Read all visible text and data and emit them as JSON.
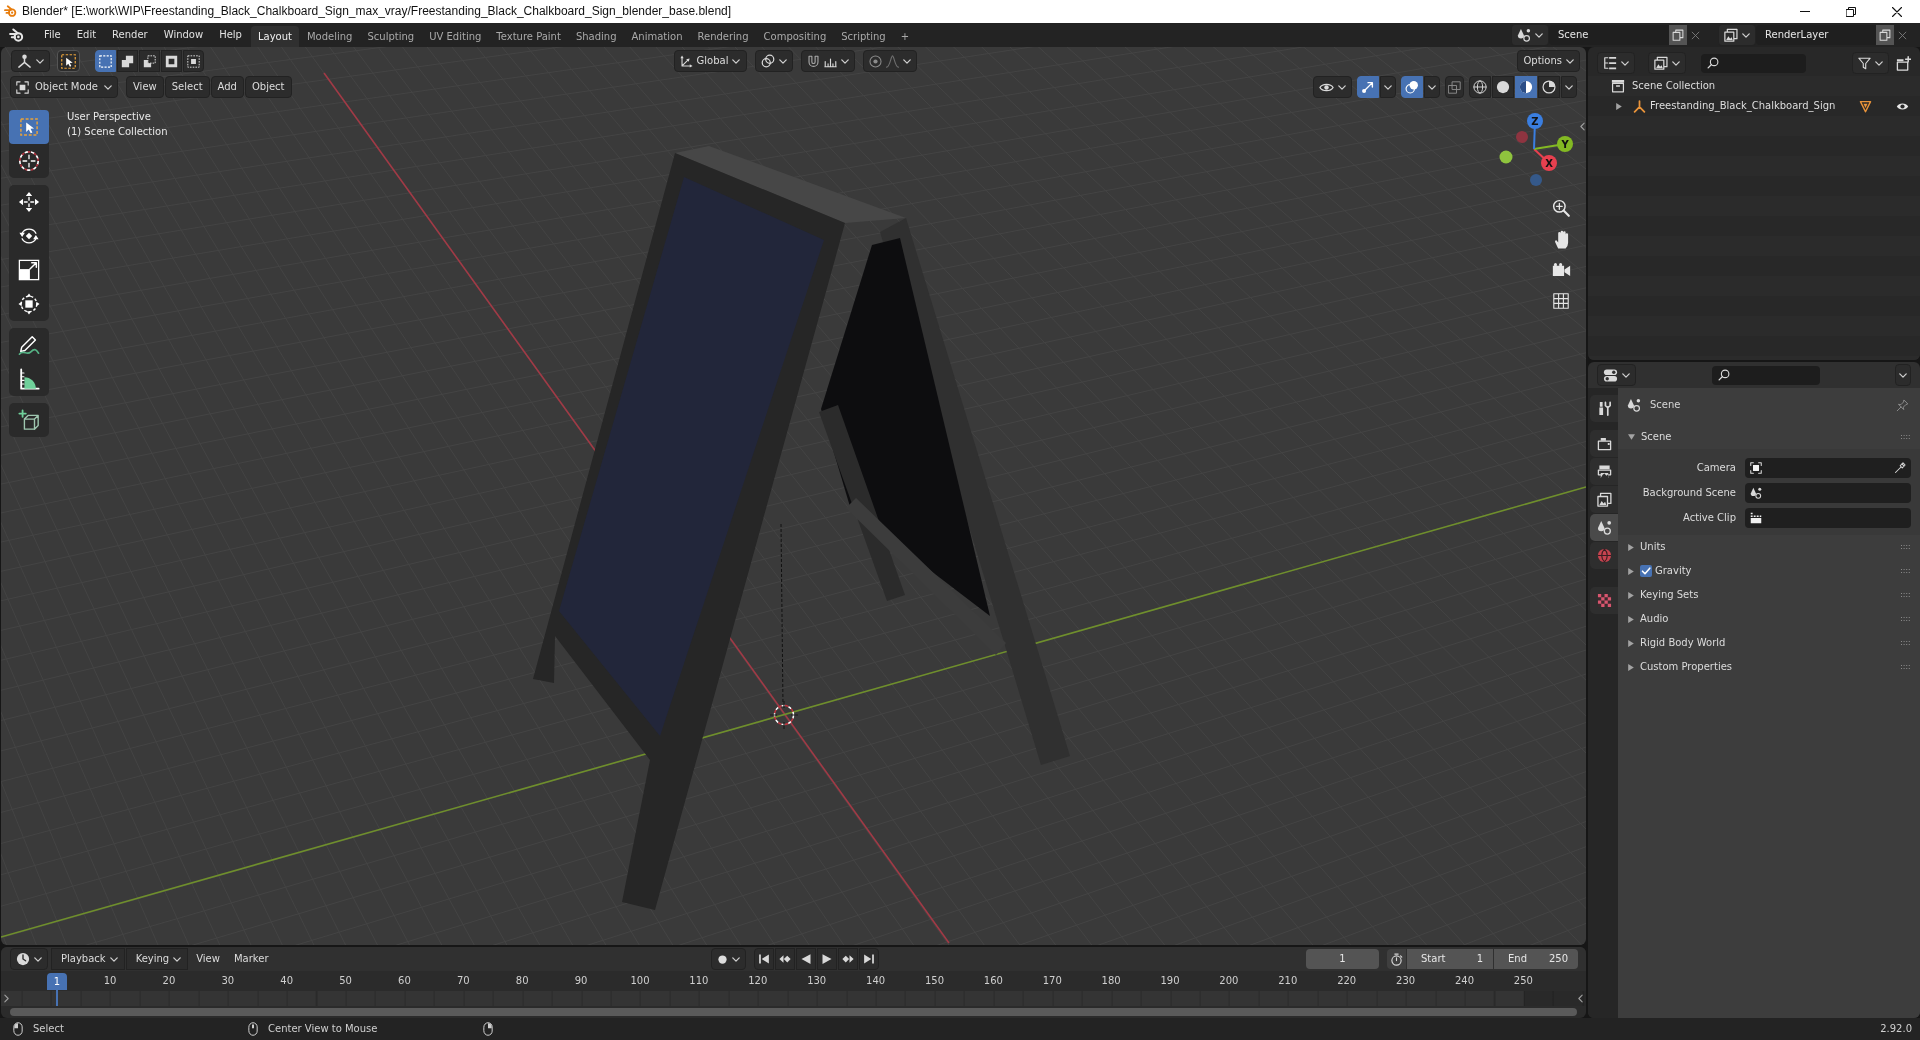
{
  "window": {
    "title": "Blender* [E:\\work\\WIP\\Freestanding_Black_Chalkboard_Sign_max_vray/Freestanding_Black_Chalkboard_Sign_blender_base.blend]"
  },
  "topbar": {
    "menus": [
      "File",
      "Edit",
      "Render",
      "Window",
      "Help"
    ],
    "workspaces": [
      {
        "label": "Layout",
        "selected": true
      },
      {
        "label": "Modeling",
        "selected": false
      },
      {
        "label": "Sculpting",
        "selected": false
      },
      {
        "label": "UV Editing",
        "selected": false
      },
      {
        "label": "Texture Paint",
        "selected": false
      },
      {
        "label": "Shading",
        "selected": false
      },
      {
        "label": "Animation",
        "selected": false
      },
      {
        "label": "Rendering",
        "selected": false
      },
      {
        "label": "Compositing",
        "selected": false
      },
      {
        "label": "Scripting",
        "selected": false
      }
    ],
    "add_workspace": "+",
    "scene": "Scene",
    "view_layer": "RenderLayer"
  },
  "viewport": {
    "select_modes": [
      {
        "kind": "set",
        "selected": true
      },
      {
        "kind": "extend",
        "selected": false
      },
      {
        "kind": "subtract",
        "selected": false
      },
      {
        "kind": "invert",
        "selected": false
      },
      {
        "kind": "intersect",
        "selected": false
      }
    ],
    "orientation": "Global",
    "options": "Options",
    "mode": "Object Mode",
    "menus": [
      "View",
      "Select",
      "Add",
      "Object"
    ],
    "show_gizmo": true,
    "show_overlays": true,
    "xray": false,
    "shading": [
      {
        "kind": "wireframe",
        "selected": false
      },
      {
        "kind": "solid",
        "selected": false
      },
      {
        "kind": "material",
        "selected": true
      },
      {
        "kind": "rendered",
        "selected": false
      }
    ],
    "info": [
      "User Perspective",
      "(1) Scene Collection"
    ],
    "tool_groups": [
      [
        {
          "kind": "select",
          "selected": true
        },
        {
          "kind": "cursor",
          "selected": false
        }
      ],
      [
        {
          "kind": "move",
          "selected": false
        },
        {
          "kind": "rotate",
          "selected": false
        },
        {
          "kind": "scale",
          "selected": false
        },
        {
          "kind": "transform",
          "selected": false
        }
      ],
      [
        {
          "kind": "annotate",
          "selected": false
        },
        {
          "kind": "measure",
          "selected": false
        }
      ],
      [
        {
          "kind": "add_cube",
          "selected": false
        }
      ]
    ],
    "gizmo_axes": [
      "X",
      "Y",
      "Z"
    ]
  },
  "outliner": {
    "root": "Scene Collection",
    "items": [
      {
        "label": "Freestanding_Black_Chalkboard_Sign",
        "expanded": false,
        "visible": true
      }
    ]
  },
  "properties": {
    "tab_groups": [
      [
        {
          "kind": "tool",
          "selected": false
        }
      ],
      [
        {
          "kind": "render",
          "selected": false
        },
        {
          "kind": "output",
          "selected": false
        },
        {
          "kind": "view_layer",
          "selected": false
        },
        {
          "kind": "scene",
          "selected": true
        },
        {
          "kind": "world",
          "selected": false
        }
      ],
      [
        {
          "kind": "texture",
          "selected": false
        }
      ]
    ],
    "context": "Scene",
    "panels": [
      {
        "kind": "fields",
        "label": "Scene",
        "expanded": true,
        "fields": [
          {
            "kind": "camera",
            "label": "Camera"
          },
          {
            "kind": "scene",
            "label": "Background Scene"
          },
          {
            "kind": "clip",
            "label": "Active Clip"
          }
        ]
      },
      {
        "kind": "plain",
        "label": "Units",
        "expanded": false
      },
      {
        "kind": "checkbox",
        "label": "Gravity",
        "expanded": false,
        "checked": true
      },
      {
        "kind": "plain",
        "label": "Keying Sets",
        "expanded": false
      },
      {
        "kind": "plain",
        "label": "Audio",
        "expanded": false
      },
      {
        "kind": "plain",
        "label": "Rigid Body World",
        "expanded": false
      },
      {
        "kind": "plain",
        "label": "Custom Properties",
        "expanded": false
      }
    ]
  },
  "timeline": {
    "menus": [
      {
        "kind": "dropdown",
        "label": "Playback"
      },
      {
        "kind": "dropdown",
        "label": "Keying"
      },
      {
        "kind": "menu",
        "label": "View"
      },
      {
        "kind": "menu",
        "label": "Marker"
      }
    ],
    "current_frame": "1",
    "start": {
      "label": "Start",
      "value": "1"
    },
    "end": {
      "label": "End",
      "value": "250"
    },
    "playhead": "1",
    "ruler": [
      "10",
      "20",
      "30",
      "40",
      "50",
      "60",
      "70",
      "80",
      "90",
      "100",
      "110",
      "120",
      "130",
      "140",
      "150",
      "160",
      "170",
      "180",
      "190",
      "200",
      "210",
      "220",
      "230",
      "240",
      "250"
    ]
  },
  "status_bar": {
    "hints": [
      {
        "kind": "left",
        "label": "Select"
      },
      {
        "kind": "middle",
        "label": "Center View to Mouse"
      },
      {
        "kind": "right"
      }
    ],
    "version": "2.92.0"
  }
}
